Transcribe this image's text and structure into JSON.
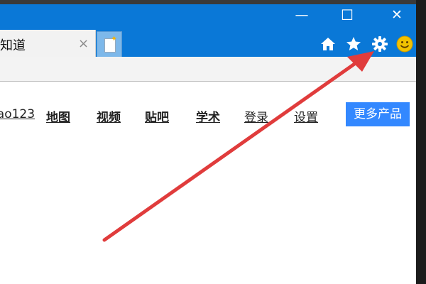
{
  "window_controls": {
    "minimize": "—",
    "maximize": "☐",
    "close": "✕"
  },
  "tab": {
    "title": "知道",
    "close": "×"
  },
  "toolbar_icons": [
    "home-icon",
    "star-icon",
    "gear-icon",
    "smiley-icon"
  ],
  "nav": {
    "links": [
      "hao123",
      "地图",
      "视频",
      "贴吧",
      "学术",
      "登录",
      "设置"
    ],
    "more_button": "更多产品"
  },
  "colors": {
    "titlebar": "#0a78d7",
    "more_button": "#3388ff",
    "arrow": "#e03c3c",
    "smiley": "#f2c200"
  }
}
